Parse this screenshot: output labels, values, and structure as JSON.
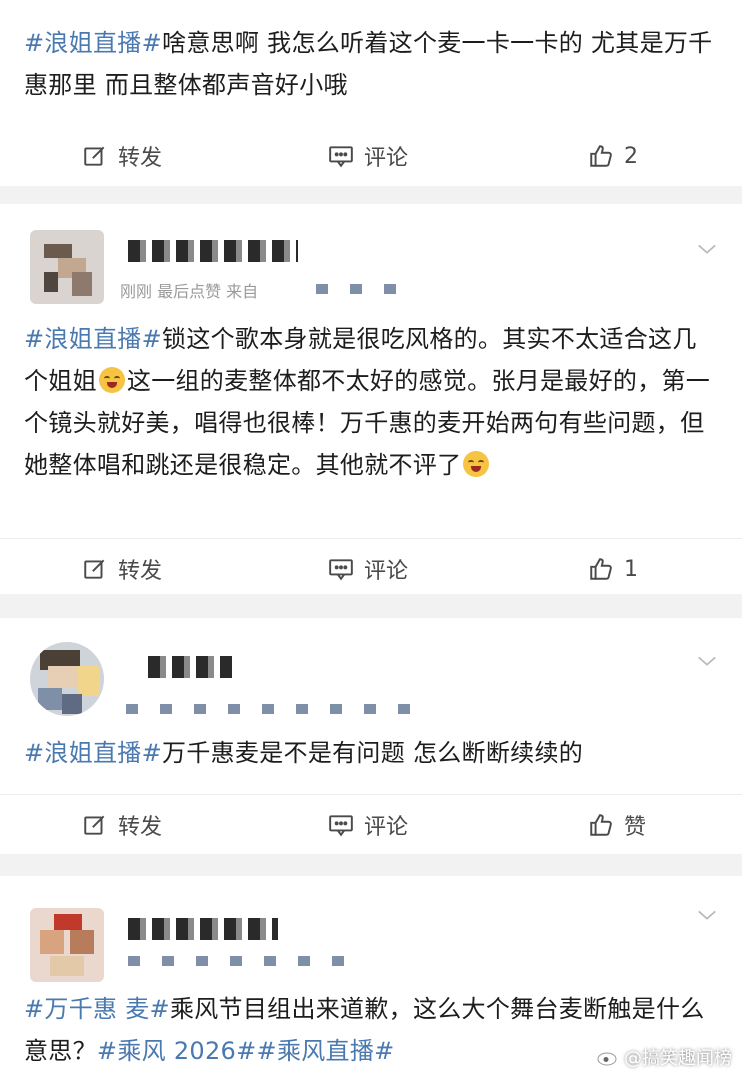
{
  "colors": {
    "tag": "#4a79b0",
    "text": "#1d1d1d",
    "action": "#4a4a4a",
    "meta": "#9a9a9a",
    "separator": "#f2f2f2"
  },
  "actions": {
    "share_label": "转发",
    "comment_label": "评论",
    "like_label_default": "赞",
    "share_icon": "share-edit-icon",
    "comment_icon": "comment-icon",
    "like_icon": "thumbs-up-icon"
  },
  "posts": [
    {
      "segments": [
        {
          "t": "#浪姐直播#",
          "tag": true
        },
        {
          "t": "啥意思啊 我怎么听着这个麦一卡一卡的 尤其是万千惠那里 而且整体都声音好小哦",
          "tag": false
        }
      ],
      "likes": "2"
    },
    {
      "meta": "刚刚 最后点赞 来自",
      "segments": [
        {
          "t": "#浪姐直播#",
          "tag": true
        },
        {
          "t": "锁这个歌本身就是很吃风格的。其实不太适合这几个姐姐",
          "tag": false
        },
        {
          "emoji": "laugh-cry-emoji"
        },
        {
          "t": "这一组的麦整体都不太好的感觉。张月是最好的，第一个镜头就好美，唱得也很棒！万千惠的麦开始两句有些问题，但她整体唱和跳还是很稳定。其他就不评了",
          "tag": false
        },
        {
          "emoji": "laugh-cry-emoji"
        }
      ],
      "likes": "1"
    },
    {
      "segments": [
        {
          "t": "#浪姐直播#",
          "tag": true
        },
        {
          "t": "万千惠麦是不是有问题 怎么断断续续的",
          "tag": false
        }
      ],
      "likes": "赞"
    },
    {
      "segments": [
        {
          "t": "#万千惠 麦#",
          "tag": true
        },
        {
          "t": "乘风节目组出来道歉，这么大个舞台麦断触是什么意思？",
          "tag": false
        },
        {
          "t": "#乘风 2026##乘风直播#",
          "tag": true
        }
      ]
    }
  ],
  "watermark": {
    "text": "@搞笑趣闻榜",
    "icon": "weibo-logo-icon"
  }
}
